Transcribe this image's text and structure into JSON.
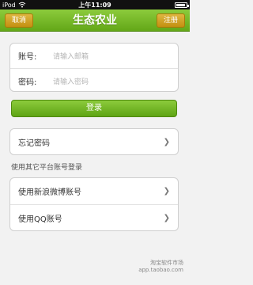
{
  "status_bar": {
    "carrier": "iPod",
    "time": "上午11:09"
  },
  "nav": {
    "cancel_label": "取消",
    "title": "生态农业",
    "register_label": "注册"
  },
  "login_form": {
    "account_label": "账号:",
    "account_placeholder": "请输入邮箱",
    "password_label": "密码:",
    "password_placeholder": "请输入密码"
  },
  "login_button": "登录",
  "forgot_password": "忘记密码",
  "other_login_title": "使用其它平台账号登录",
  "social_logins": [
    "使用新浪微博账号",
    "使用QQ账号"
  ],
  "watermark": {
    "line1": "淘宝软件市场",
    "line2": "app.taobao.com"
  },
  "colors": {
    "nav_green": "#6bb022",
    "button_gold": "#c9961a"
  }
}
